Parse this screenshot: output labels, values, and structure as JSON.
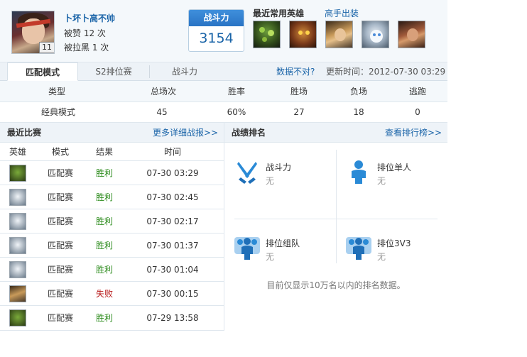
{
  "player": {
    "name": "卜坏卜高不帅",
    "level": "11",
    "likes": "被赞 12 次",
    "blocks": "被拉黑 1 次"
  },
  "power": {
    "title": "战斗力",
    "value": "3154"
  },
  "recent_heroes": {
    "label": "最近常用英雄",
    "expert_link": "高手出装",
    "icons": [
      "hero-icon-1",
      "hero-icon-2",
      "hero-icon-3",
      "hero-icon-4",
      "hero-icon-5"
    ]
  },
  "tabs": [
    {
      "label": "匹配模式",
      "active": true
    },
    {
      "label": "S2排位赛",
      "active": false
    },
    {
      "label": "战斗力",
      "active": false
    }
  ],
  "data_wrong": "数据不对?",
  "update_time": "更新时间：2012-07-30 03:29",
  "stats": {
    "headers": [
      "类型",
      "总场次",
      "胜率",
      "胜场",
      "负场",
      "逃跑"
    ],
    "row": [
      "经典模式",
      "45",
      "60%",
      "27",
      "18",
      "0"
    ]
  },
  "recent_matches": {
    "title": "最近比赛",
    "more_link": "更多详细战报>>",
    "headers": [
      "英雄",
      "模式",
      "结果",
      "时间"
    ],
    "rows": [
      {
        "mode": "匹配赛",
        "result": "胜利",
        "time": "07-30 03:29",
        "win": true
      },
      {
        "mode": "匹配赛",
        "result": "胜利",
        "time": "07-30 02:45",
        "win": true
      },
      {
        "mode": "匹配赛",
        "result": "胜利",
        "time": "07-30 02:17",
        "win": true
      },
      {
        "mode": "匹配赛",
        "result": "胜利",
        "time": "07-30 01:37",
        "win": true
      },
      {
        "mode": "匹配赛",
        "result": "胜利",
        "time": "07-30 01:04",
        "win": true
      },
      {
        "mode": "匹配赛",
        "result": "失败",
        "time": "07-30 00:15",
        "win": false
      },
      {
        "mode": "匹配赛",
        "result": "胜利",
        "time": "07-29 13:58",
        "win": true
      }
    ]
  },
  "ranking": {
    "title": "战绩排名",
    "more_link": "查看排行榜>>",
    "items": [
      {
        "name": "战斗力",
        "value": "无"
      },
      {
        "name": "排位单人",
        "value": "无"
      },
      {
        "name": "排位组队",
        "value": "无"
      },
      {
        "name": "排位3V3",
        "value": "无"
      }
    ],
    "note": "目前仅显示10万名以内的排名数据。"
  },
  "colors": {
    "link": "#1a64a8",
    "win": "#2a8a1a",
    "lose": "#b81a1a",
    "power_header": "#2a74c5",
    "rank_icon": "#2a8ad6"
  }
}
